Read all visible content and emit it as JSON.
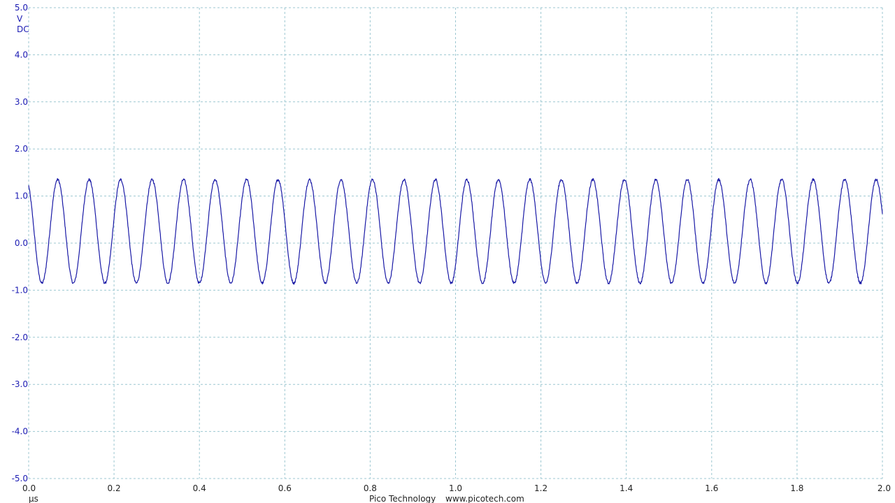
{
  "chart_data": {
    "type": "line",
    "ylim": [
      -5.0,
      5.0
    ],
    "xlim": [
      0.0,
      2.0
    ],
    "y_ticks": [
      "5.0",
      "4.0",
      "3.0",
      "2.0",
      "1.0",
      "0.0",
      "-1.0",
      "-2.0",
      "-3.0",
      "-4.0",
      "-5.0"
    ],
    "x_ticks": [
      "0.0",
      "0.2",
      "0.4",
      "0.6",
      "0.8",
      "1.0",
      "1.2",
      "1.4",
      "1.6",
      "1.8",
      "2.0"
    ],
    "y_unit": "V",
    "coupling": "DC",
    "x_unit": "µs",
    "grid": true,
    "series": [
      {
        "color": "#1a1aa6",
        "waveform": "sine",
        "frequency_mhz": 13.56,
        "amplitude_v": 1.1,
        "offset_v": 0.25,
        "initial_value_v": 1.22,
        "final_value_v": 0.85,
        "peak_v": 1.36,
        "trough_v": -0.86,
        "cycles_shown": 27
      }
    ]
  },
  "footer": {
    "brand": "Pico Technology",
    "url": "www.picotech.com"
  },
  "colors": {
    "grid": "#9cc7d1",
    "trace": "#1a1aa6",
    "axis_labels": "#1b1bb3",
    "text": "#222222"
  }
}
